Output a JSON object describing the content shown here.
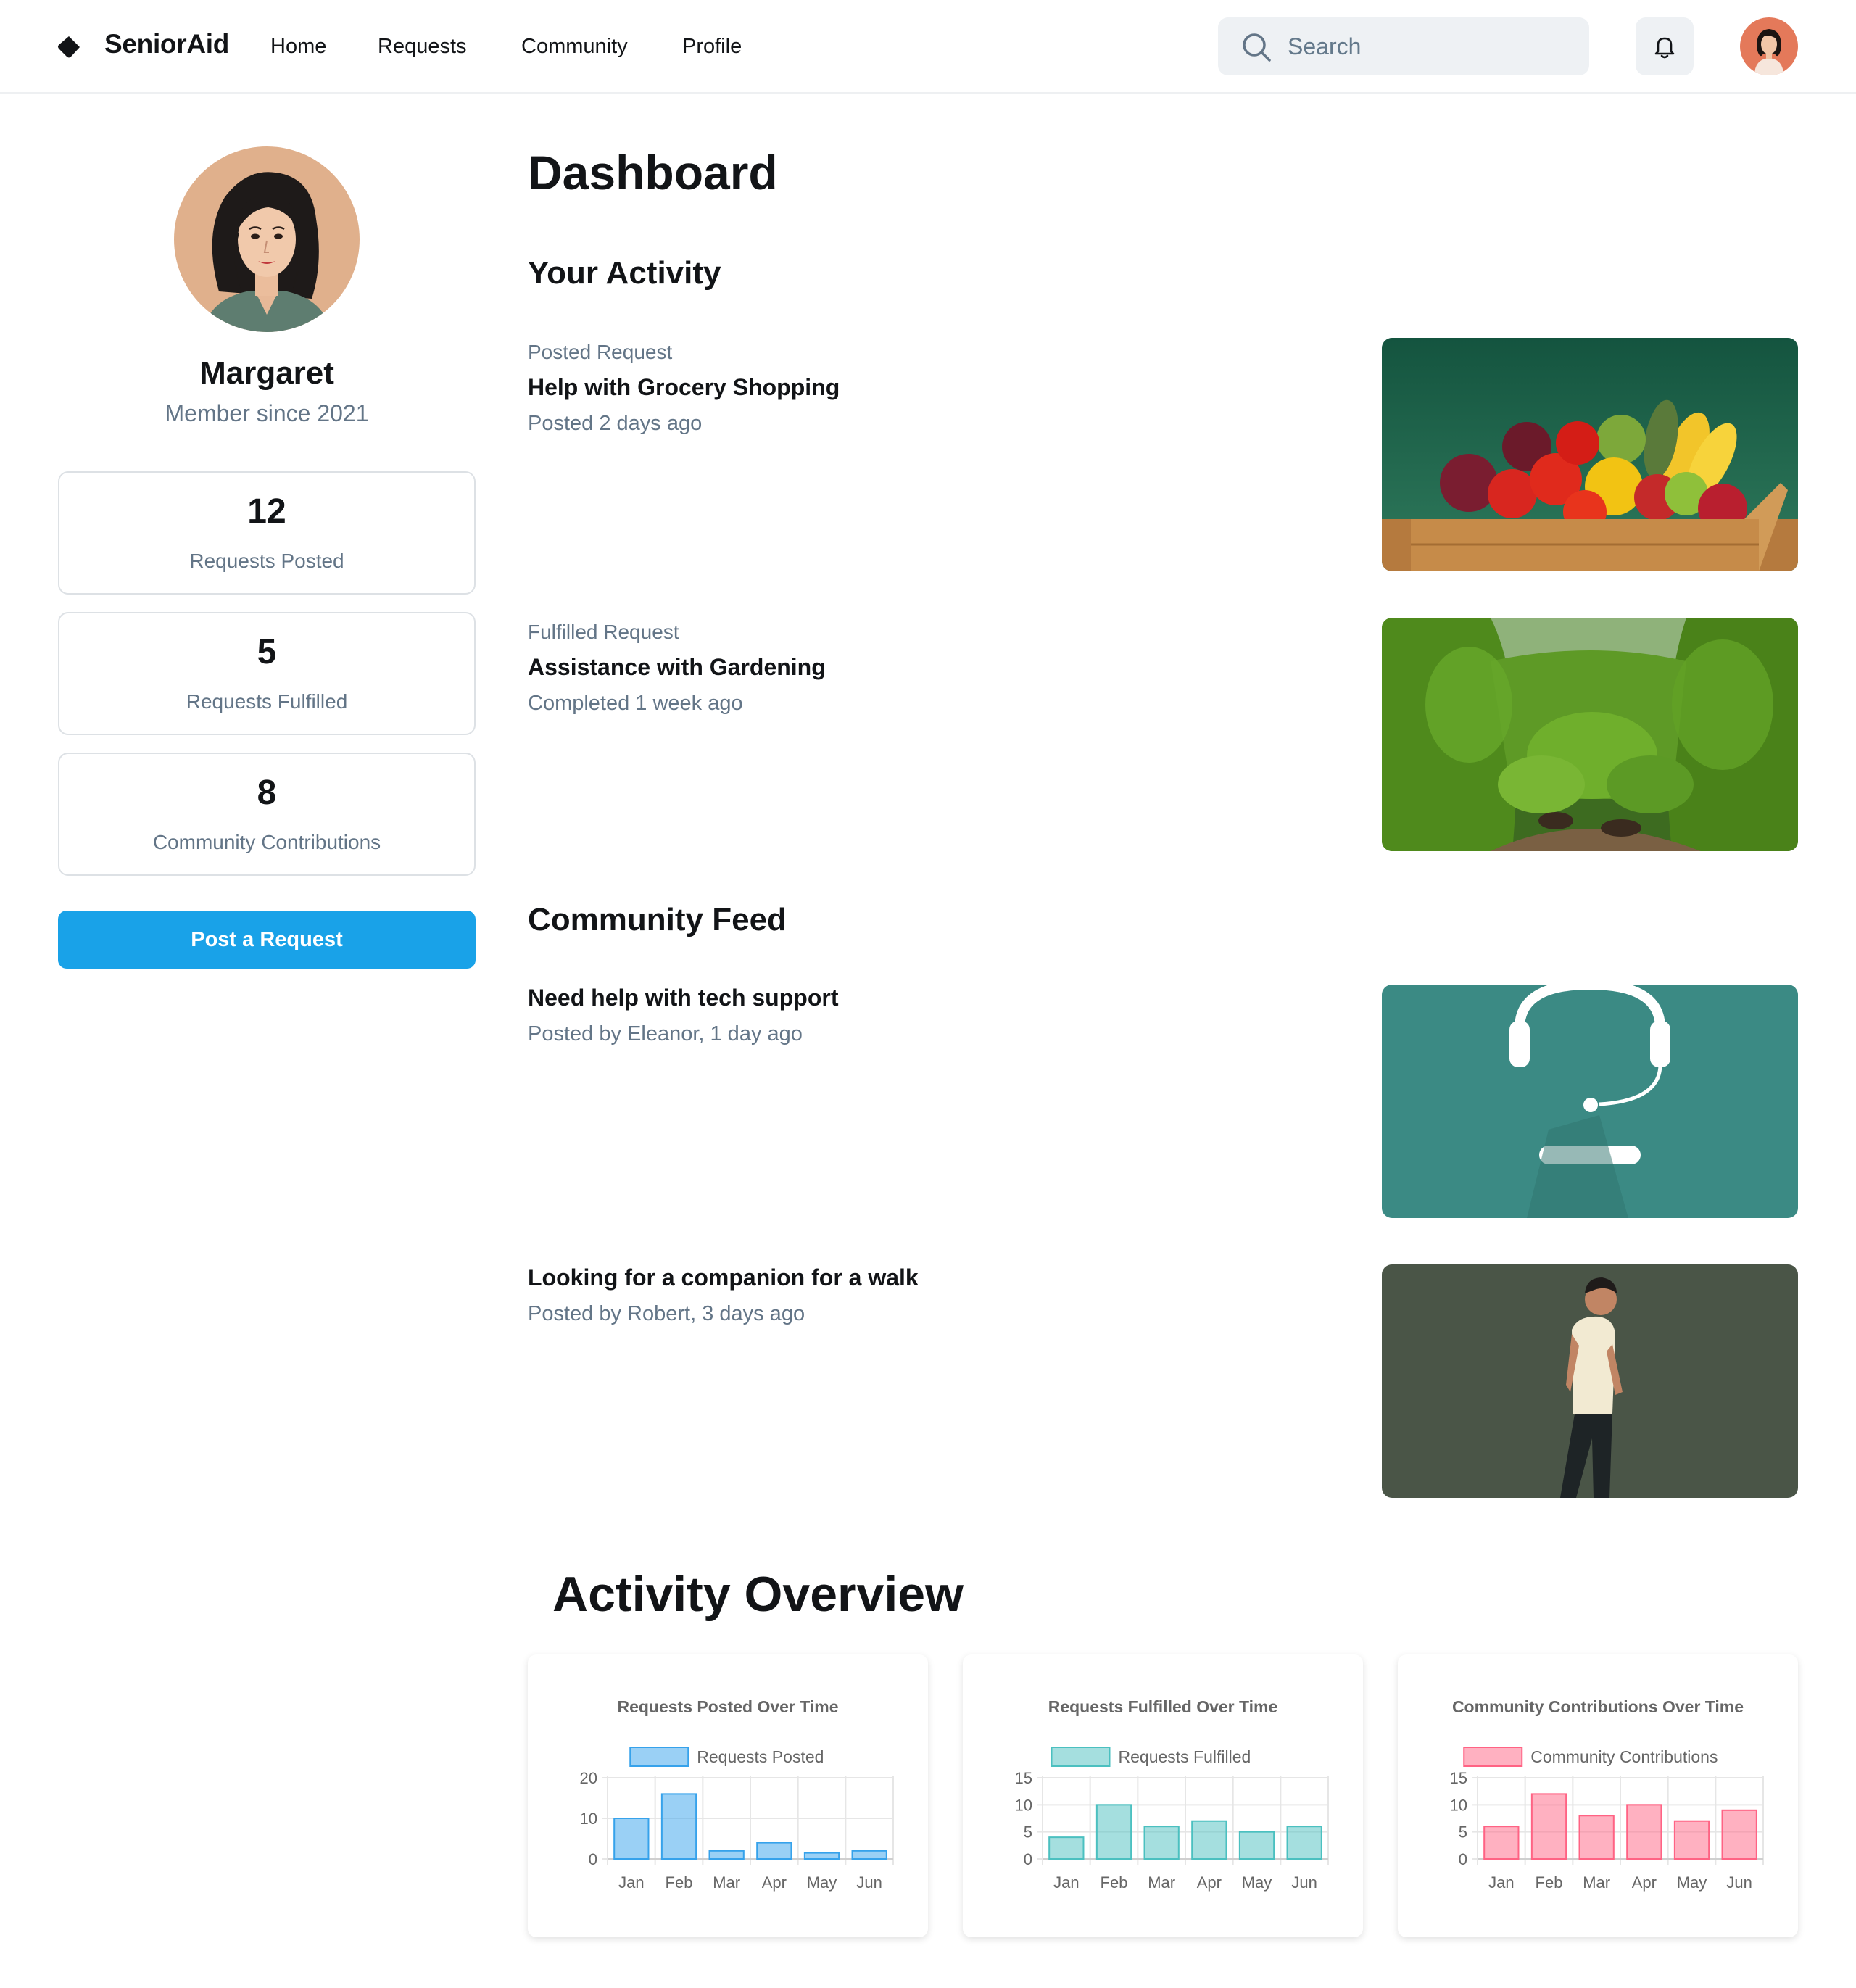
{
  "header": {
    "brand": "SeniorAid",
    "nav": [
      "Home",
      "Requests",
      "Community",
      "Profile"
    ],
    "search_placeholder": "Search"
  },
  "profile": {
    "name": "Margaret",
    "member_since": "Member since 2021"
  },
  "stats": [
    {
      "value": "12",
      "label": "Requests Posted"
    },
    {
      "value": "5",
      "label": "Requests Fulfilled"
    },
    {
      "value": "8",
      "label": "Community Contributions"
    }
  ],
  "post_button": "Post a Request",
  "main": {
    "title": "Dashboard",
    "activity_heading": "Your Activity",
    "activity": [
      {
        "kind": "Posted Request",
        "title": "Help with Grocery Shopping",
        "sub": "Posted 2 days ago"
      },
      {
        "kind": "Fulfilled Request",
        "title": "Assistance with Gardening",
        "sub": "Completed 1 week ago"
      }
    ],
    "feed_heading": "Community Feed",
    "feed": [
      {
        "title": "Need help with tech support",
        "sub": "Posted by Eleanor, 1 day ago"
      },
      {
        "title": "Looking for a companion for a walk",
        "sub": "Posted by Robert, 3 days ago"
      }
    ],
    "overview_heading": "Activity Overview"
  },
  "colors": {
    "accent": "#19a2e8",
    "posted": "#36a2eb",
    "fulfilled": "#4bc0c0",
    "contrib": "#ff6384"
  },
  "chart_data": [
    {
      "type": "bar",
      "title": "Requests Posted Over Time",
      "categories": [
        "Jan",
        "Feb",
        "Mar",
        "Apr",
        "May",
        "Jun"
      ],
      "series": [
        {
          "name": "Requests Posted",
          "values": [
            10,
            16,
            2,
            4,
            1.5,
            2
          ]
        }
      ],
      "ylim": [
        0,
        20
      ],
      "yticks": [
        0,
        10,
        20
      ],
      "legend": "top"
    },
    {
      "type": "bar",
      "title": "Requests Fulfilled Over Time",
      "categories": [
        "Jan",
        "Feb",
        "Mar",
        "Apr",
        "May",
        "Jun"
      ],
      "series": [
        {
          "name": "Requests Fulfilled",
          "values": [
            4,
            10,
            6,
            7,
            5,
            6
          ]
        }
      ],
      "ylim": [
        0,
        15
      ],
      "yticks": [
        0,
        5,
        10,
        15
      ],
      "legend": "top"
    },
    {
      "type": "bar",
      "title": "Community Contributions Over Time",
      "categories": [
        "Jan",
        "Feb",
        "Mar",
        "Apr",
        "May",
        "Jun"
      ],
      "series": [
        {
          "name": "Community Contributions",
          "values": [
            6,
            12,
            8,
            10,
            7,
            9
          ]
        }
      ],
      "ylim": [
        0,
        15
      ],
      "yticks": [
        0,
        5,
        10,
        15
      ],
      "legend": "top"
    }
  ]
}
